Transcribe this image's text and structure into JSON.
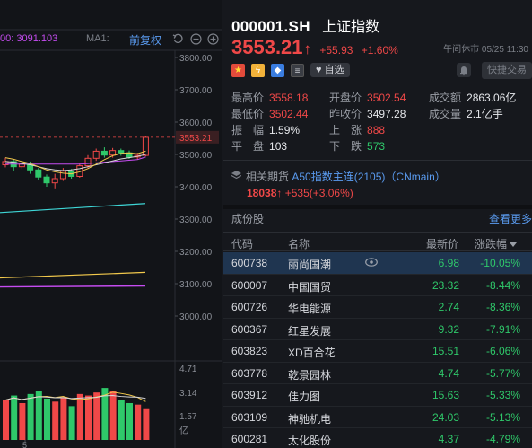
{
  "chart": {
    "ma_readout": "00: 3091.103",
    "ma1_label": "MA1:",
    "adjust_label": "前复权",
    "price_axis": [
      "3800.00",
      "3700.00",
      "3600.00",
      "3500.00",
      "3400.00",
      "3300.00",
      "3200.00",
      "3100.00",
      "3000.00"
    ],
    "current_price_tag": "3553.21",
    "volume_axis": [
      "4.71",
      "3.14",
      "1.57",
      "亿"
    ],
    "date_tick": "5",
    "colors": {
      "up": "#f04848",
      "down": "#2fc86a",
      "ma5": "#f2c94c",
      "ma10": "#d8d8d8",
      "ma20": "#c54cf0",
      "ma60": "#3ed6d6",
      "bg": "#121418"
    },
    "candles": [
      {
        "o": 3468,
        "c": 3478,
        "h": 3490,
        "l": 3460
      },
      {
        "o": 3478,
        "c": 3462,
        "h": 3484,
        "l": 3450
      },
      {
        "o": 3462,
        "c": 3470,
        "h": 3480,
        "l": 3455
      },
      {
        "o": 3470,
        "c": 3452,
        "h": 3478,
        "l": 3440
      },
      {
        "o": 3452,
        "c": 3430,
        "h": 3458,
        "l": 3420
      },
      {
        "o": 3430,
        "c": 3412,
        "h": 3438,
        "l": 3400
      },
      {
        "o": 3412,
        "c": 3425,
        "h": 3440,
        "l": 3395
      },
      {
        "o": 3425,
        "c": 3448,
        "h": 3458,
        "l": 3418
      },
      {
        "o": 3448,
        "c": 3432,
        "h": 3455,
        "l": 3425
      },
      {
        "o": 3432,
        "c": 3465,
        "h": 3472,
        "l": 3428
      },
      {
        "o": 3465,
        "c": 3488,
        "h": 3498,
        "l": 3458
      },
      {
        "o": 3488,
        "c": 3510,
        "h": 3518,
        "l": 3480
      },
      {
        "o": 3510,
        "c": 3498,
        "h": 3522,
        "l": 3490
      },
      {
        "o": 3498,
        "c": 3512,
        "h": 3520,
        "l": 3490
      },
      {
        "o": 3512,
        "c": 3505,
        "h": 3518,
        "l": 3496
      },
      {
        "o": 3505,
        "c": 3492,
        "h": 3512,
        "l": 3486
      },
      {
        "o": 3492,
        "c": 3497,
        "h": 3505,
        "l": 3484
      },
      {
        "o": 3497,
        "c": 3553,
        "h": 3558,
        "l": 3494
      }
    ],
    "ma5": [
      3490,
      3485,
      3478,
      3472,
      3462,
      3452,
      3446,
      3442,
      3440,
      3446,
      3456,
      3470,
      3484,
      3496,
      3503,
      3505,
      3502,
      3510
    ],
    "ma10": [
      3478,
      3476,
      3472,
      3468,
      3462,
      3456,
      3452,
      3450,
      3452,
      3456,
      3462,
      3468,
      3474,
      3480,
      3486,
      3490,
      3494,
      3500
    ],
    "ma20": [
      3470,
      3470,
      3470,
      3470,
      3470,
      3470,
      3470,
      3470,
      3470,
      3470,
      3472,
      3474,
      3476,
      3478,
      3480,
      3482,
      3484,
      3492
    ],
    "ma60_line": [
      3320,
      3348
    ],
    "ma120_line": [
      3118,
      3135
    ],
    "ma250_line": [
      3090,
      3093
    ],
    "volumes": [
      2.6,
      2.9,
      2.4,
      3.0,
      3.2,
      2.7,
      2.5,
      2.8,
      2.2,
      3.0,
      2.9,
      3.1,
      3.4,
      3.2,
      2.6,
      2.4,
      2.3,
      2.0
    ]
  },
  "quote": {
    "code": "000001.SH",
    "name": "上证指数",
    "price": "3553.21",
    "arrow": "↑",
    "change_abs": "+55.93",
    "change_pct": "+1.60%",
    "status": "午间休市 05/25 11:30",
    "watch_label": "自选",
    "quick_trade": "快捷交易",
    "tags": [
      "china-flag-icon",
      "flash-icon",
      "label-icon",
      "document-icon"
    ],
    "stats": {
      "high_label": "最高价",
      "high": "3558.18",
      "low_label": "最低价",
      "low": "3502.44",
      "open_label": "开盘价",
      "open": "3502.54",
      "prev_label": "昨收价",
      "prev": "3497.28",
      "amount_label": "成交额",
      "amount": "2863.06亿",
      "volume_label": "成交量",
      "volume": "2.1亿手",
      "amp_label": "振　幅",
      "amp": "1.59%",
      "flat_label": "平　盘",
      "flat": "103",
      "up_label": "上　涨",
      "up": "888",
      "down_label": "下　跌",
      "down": "573"
    },
    "futures": {
      "label": "相关期货",
      "name": "A50指数主连(2105)（CNmain）",
      "price": "18038",
      "arrow": "↑",
      "change": "+535(+3.06%)"
    }
  },
  "components": {
    "title": "成份股",
    "see_more": "查看更多",
    "headers": {
      "code": "代码",
      "name": "名称",
      "price": "最新价",
      "change": "涨跌幅"
    },
    "rows": [
      {
        "code": "600738",
        "name": "丽尚国潮",
        "price": "6.98",
        "change": "-10.05%"
      },
      {
        "code": "600007",
        "name": "中国国贸",
        "price": "23.32",
        "change": "-8.44%"
      },
      {
        "code": "600726",
        "name": "华电能源",
        "price": "2.74",
        "change": "-8.36%"
      },
      {
        "code": "600367",
        "name": "红星发展",
        "price": "9.32",
        "change": "-7.91%"
      },
      {
        "code": "603823",
        "name": "XD百合花",
        "price": "15.51",
        "change": "-6.06%"
      },
      {
        "code": "603778",
        "name": "乾景园林",
        "price": "4.74",
        "change": "-5.77%"
      },
      {
        "code": "603912",
        "name": "佳力图",
        "price": "15.63",
        "change": "-5.33%"
      },
      {
        "code": "603109",
        "name": "神驰机电",
        "price": "24.03",
        "change": "-5.13%"
      },
      {
        "code": "600281",
        "name": "太化股份",
        "price": "4.37",
        "change": "-4.79%"
      }
    ]
  }
}
